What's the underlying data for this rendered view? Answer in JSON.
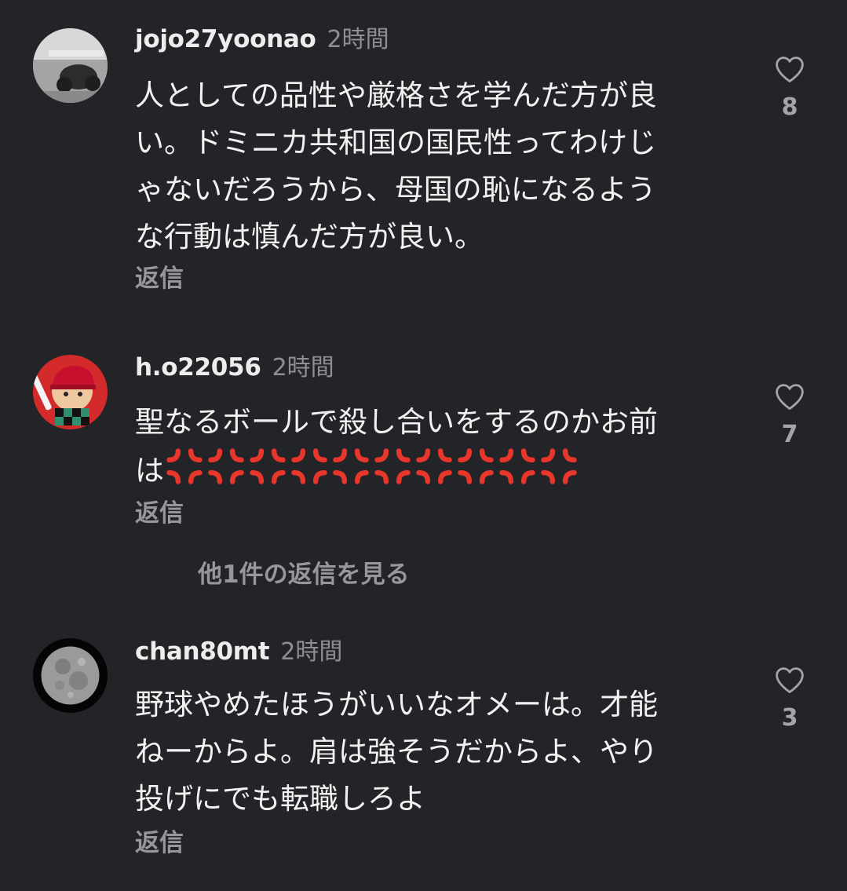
{
  "comments": [
    {
      "username": "jojo27yoonao",
      "time": "2時間",
      "lines": [
        "人としての品性や厳格さを学んだ方が良",
        "い。ドミニカ共和国の国民性ってわけじ",
        "ゃないだろうから、母国の恥になるよう",
        "な行動は慎んだ方が良い。"
      ],
      "reply_label": "返信",
      "likes": "8"
    },
    {
      "username": "h.o22056",
      "time": "2時間",
      "lines": [
        "聖なるボールで殺し合いをするのかお前",
        "は"
      ],
      "emoji_name": "anger-symbol",
      "emoji_count": 10,
      "reply_label": "返信",
      "likes": "7",
      "view_replies_label": "他1件の返信を見る"
    },
    {
      "username": "chan80mt",
      "time": "2時間",
      "lines": [
        "野球やめたほうがいいなオメーは。才能",
        "ねーからよ。肩は強そうだからよ、やり",
        "投げにでも転職しろよ"
      ],
      "reply_label": "返信",
      "likes": "3"
    }
  ],
  "colors": {
    "background": "#232428",
    "text": "#f2f2f2",
    "secondary": "#8d8f95",
    "anger": "#e8362a"
  },
  "icons": {
    "like": "heart-outline-icon",
    "emoji": "anger-symbol-icon"
  }
}
